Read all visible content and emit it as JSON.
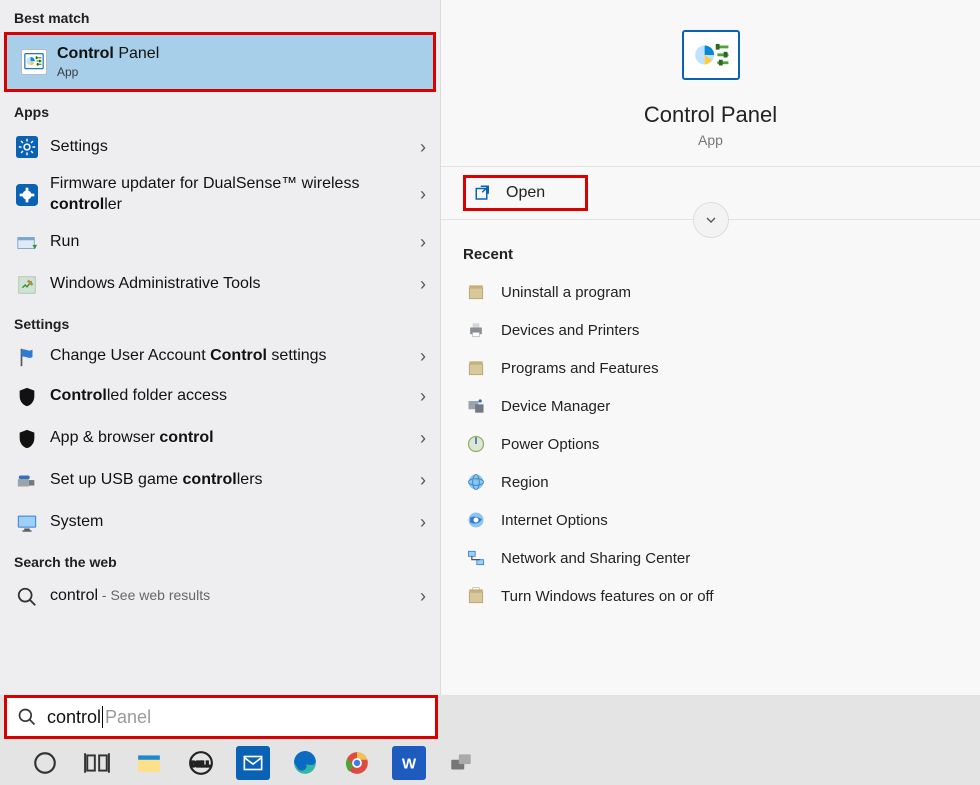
{
  "sections": {
    "best_match": "Best match",
    "apps": "Apps",
    "settings": "Settings",
    "search_web": "Search the web",
    "recent": "Recent"
  },
  "best_match": {
    "title_prefix": "Control",
    "title_rest": " Panel",
    "subtitle": "App"
  },
  "apps": [
    {
      "label_html": "Settings",
      "icon": "gear"
    },
    {
      "label_html": "Firmware updater for DualSense™ wireless <b>control</b>ler",
      "icon": "firmware"
    },
    {
      "label_html": "Run",
      "icon": "run"
    },
    {
      "label_html": "Windows Administrative Tools",
      "icon": "admin"
    }
  ],
  "settings_items": [
    {
      "label_html": "Change User Account <b>Control</b> settings",
      "icon": "flag"
    },
    {
      "label_html": "<b>Control</b>led folder access",
      "icon": "shield"
    },
    {
      "label_html": "App & browser <b>control</b>",
      "icon": "shield"
    },
    {
      "label_html": "Set up USB game <b>control</b>lers",
      "icon": "usb"
    },
    {
      "label_html": "System",
      "icon": "monitor"
    }
  ],
  "web_results": [
    {
      "prefix": "control",
      "suffix": " - See web results"
    }
  ],
  "search": {
    "typed": "control",
    "suggestion": " Panel"
  },
  "right": {
    "title": "Control Panel",
    "subtitle": "App",
    "open_label": "Open"
  },
  "recent_items": [
    "Uninstall a program",
    "Devices and Printers",
    "Programs and Features",
    "Device Manager",
    "Power Options",
    "Region",
    "Internet Options",
    "Network and Sharing Center",
    "Turn Windows features on or off"
  ],
  "taskbar": {
    "icons": [
      "cortana",
      "task-view",
      "file-explorer",
      "dell",
      "mail",
      "edge",
      "chrome",
      "word",
      "settings"
    ]
  }
}
